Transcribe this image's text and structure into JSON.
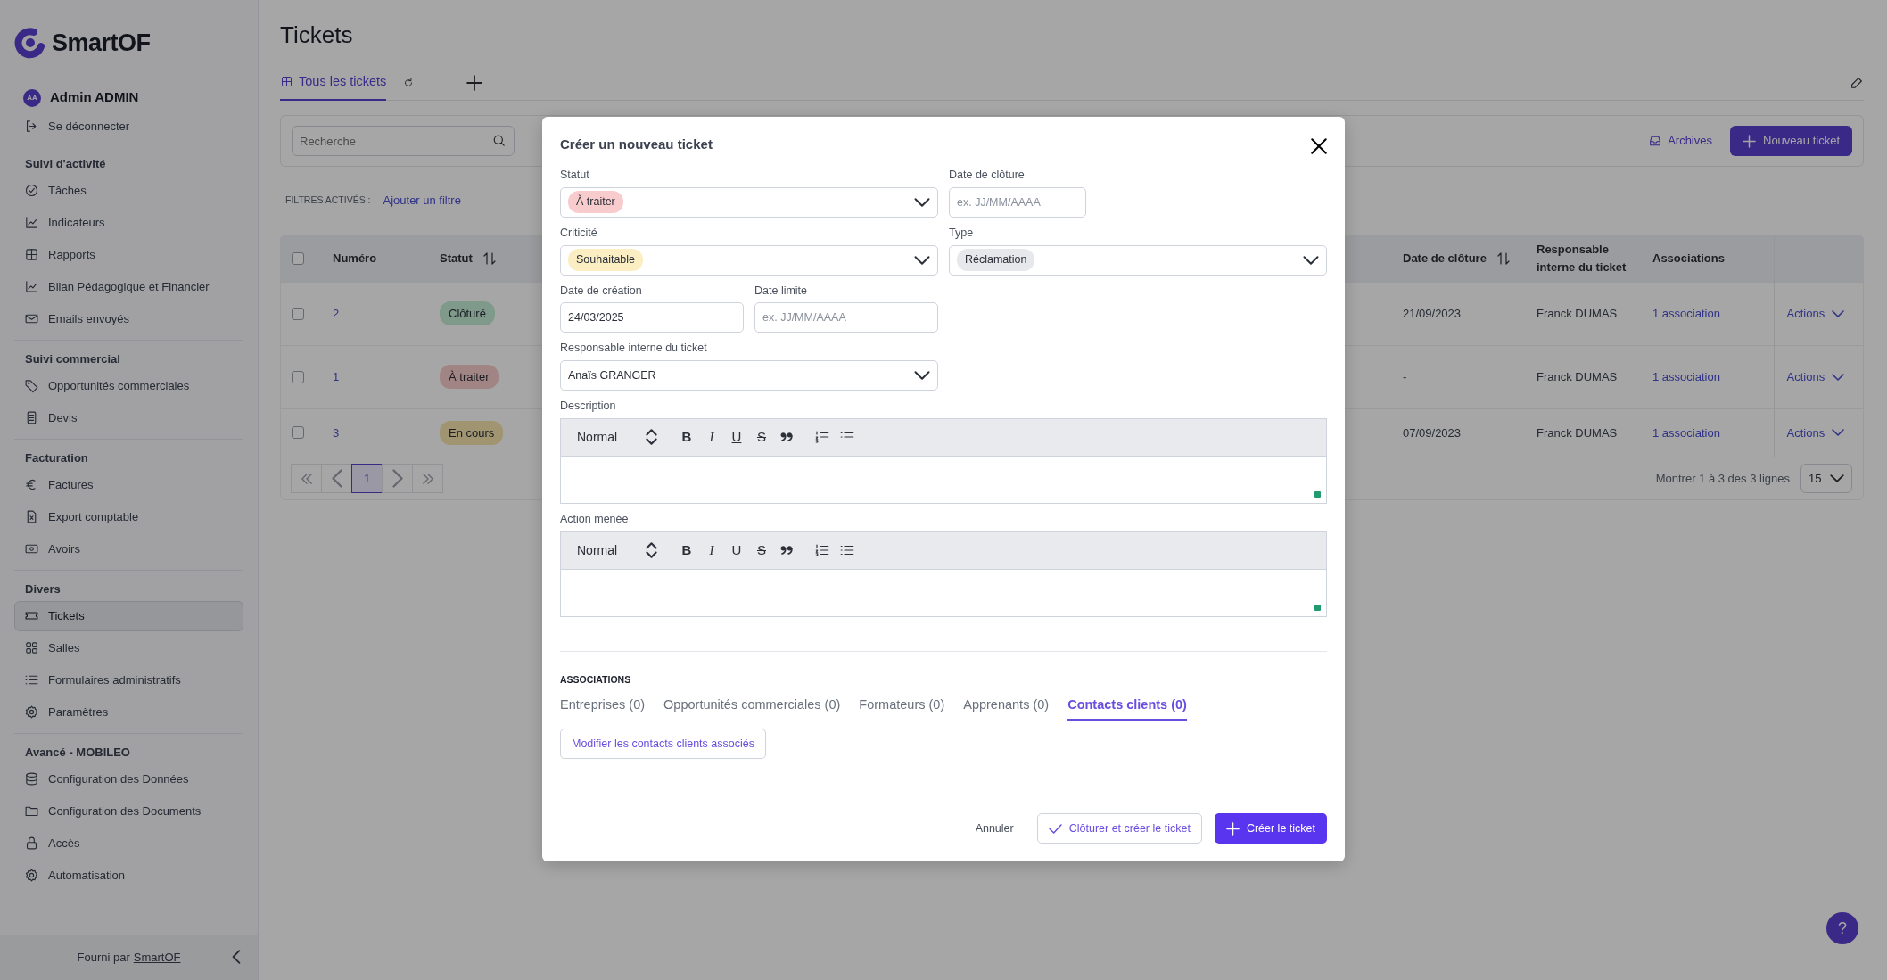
{
  "sidebar": {
    "logo": "SmartOF",
    "user": {
      "initials": "AA",
      "name": "Admin ADMIN"
    },
    "logout": "Se déconnecter",
    "sections": [
      {
        "title": "Suivi d'activité",
        "items": [
          {
            "label": "Tâches",
            "kind": "check-circle",
            "selected": false
          },
          {
            "label": "Indicateurs",
            "kind": "chart",
            "selected": false
          },
          {
            "label": "Rapports",
            "kind": "table",
            "selected": false
          },
          {
            "label": "Bilan Pédagogique et Financier",
            "kind": "chart",
            "selected": false
          },
          {
            "label": "Emails envoyés",
            "kind": "mail",
            "selected": false
          }
        ]
      },
      {
        "title": "Suivi commercial",
        "items": [
          {
            "label": "Opportunités commerciales",
            "kind": "tag",
            "selected": false
          },
          {
            "label": "Devis",
            "kind": "document",
            "selected": false
          }
        ]
      },
      {
        "title": "Facturation",
        "items": [
          {
            "label": "Factures",
            "kind": "euro",
            "selected": false
          },
          {
            "label": "Export comptable",
            "kind": "file-x",
            "selected": false
          },
          {
            "label": "Avoirs",
            "kind": "banknote",
            "selected": false
          }
        ]
      },
      {
        "title": "Divers",
        "items": [
          {
            "label": "Tickets",
            "kind": "ticket",
            "selected": true
          },
          {
            "label": "Salles",
            "kind": "grid",
            "selected": false
          },
          {
            "label": "Formulaires administratifs",
            "kind": "list",
            "selected": false
          },
          {
            "label": "Paramètres",
            "kind": "gear",
            "selected": false
          }
        ]
      },
      {
        "title": "Avancé - MOBILEO",
        "items": [
          {
            "label": "Configuration des Données",
            "kind": "database",
            "selected": false
          },
          {
            "label": "Configuration des Documents",
            "kind": "folder",
            "selected": false
          },
          {
            "label": "Accès",
            "kind": "lock",
            "selected": false
          },
          {
            "label": "Automatisation",
            "kind": "gear",
            "selected": false
          }
        ]
      }
    ],
    "footer": {
      "text": "Fourni par",
      "link": "SmartOF"
    }
  },
  "page": {
    "title": "Tickets",
    "views": [
      {
        "label": "Tous les tickets",
        "selected": true
      }
    ],
    "search": {
      "placeholder": "Recherche"
    },
    "archives": "Archives",
    "new_ticket": "Nouveau ticket",
    "filters_label": "FILTRES ACTIVÉS :",
    "add_filter": "Ajouter un filtre",
    "table": {
      "all_checked": false,
      "columns_left": [
        {
          "label": "Numéro",
          "sortable": false
        },
        {
          "label": "Statut",
          "sortable": true
        }
      ],
      "columns_right": [
        {
          "label": "Date de clôture",
          "sortable": true
        },
        {
          "label": "Responsable interne du ticket",
          "sortable": false
        },
        {
          "label": "Associations",
          "sortable": false
        }
      ],
      "rows": [
        {
          "checked": false,
          "number": "2",
          "status": {
            "label": "Clôturé",
            "kind": "closed"
          },
          "closing_date": "21/09/2023",
          "owner": "Franck DUMAS",
          "associations": "1 association",
          "actions": "Actions"
        },
        {
          "checked": false,
          "number": "1",
          "status": {
            "label": "À traiter",
            "kind": "todo"
          },
          "closing_date": "-",
          "owner": "Franck DUMAS",
          "associations": "1 association",
          "actions": "Actions"
        },
        {
          "checked": false,
          "number": "3",
          "status": {
            "label": "En cours",
            "kind": "in-progress"
          },
          "closing_date": "07/09/2023",
          "owner": "Franck DUMAS",
          "associations": "1 association",
          "actions": "Actions"
        }
      ]
    },
    "pagination": {
      "pages": [
        {
          "label": "1",
          "selected": true
        }
      ],
      "summary": "Montrer 1 à 3 des 3 lignes",
      "page_size": "15"
    },
    "help": "?"
  },
  "modal": {
    "title": "Créer un nouveau ticket",
    "status": {
      "label": "Statut",
      "value": {
        "label": "À traiter",
        "color": "#f8cccc"
      }
    },
    "closing_date": {
      "label": "Date de clôture",
      "placeholder": "ex. JJ/MM/AAAA"
    },
    "criticality": {
      "label": "Criticité",
      "value": {
        "label": "Souhaitable",
        "color": "#fbeec2"
      }
    },
    "type": {
      "label": "Type",
      "value": {
        "label": "Réclamation",
        "color": "#e7e8ec"
      }
    },
    "creation_date": {
      "label": "Date de création",
      "value": "24/03/2025"
    },
    "due_date": {
      "label": "Date limite",
      "placeholder": "ex. JJ/MM/AAAA"
    },
    "owner": {
      "label": "Responsable interne du ticket",
      "value": "Anaïs GRANGER"
    },
    "editors": [
      {
        "label": "Description",
        "format": "Normal",
        "toolbar": [
          {
            "kind": "bold",
            "glyph": "B"
          },
          {
            "kind": "italic",
            "glyph": "I"
          },
          {
            "kind": "underline",
            "glyph": "U"
          },
          {
            "kind": "strike",
            "glyph": "S"
          },
          {
            "kind": "quote"
          },
          {
            "kind": "ordered-list"
          },
          {
            "kind": "bullet-list"
          }
        ]
      },
      {
        "label": "Action menée",
        "format": "Normal",
        "toolbar": [
          {
            "kind": "bold",
            "glyph": "B"
          },
          {
            "kind": "italic",
            "glyph": "I"
          },
          {
            "kind": "underline",
            "glyph": "U"
          },
          {
            "kind": "strike",
            "glyph": "S"
          },
          {
            "kind": "quote"
          },
          {
            "kind": "ordered-list"
          },
          {
            "kind": "bullet-list"
          }
        ]
      }
    ],
    "associations": {
      "title": "ASSOCIATIONS",
      "tabs": [
        {
          "label": "Entreprises (0)",
          "selected": false
        },
        {
          "label": "Opportunités commerciales (0)",
          "selected": false
        },
        {
          "label": "Formateurs (0)",
          "selected": false
        },
        {
          "label": "Apprenants (0)",
          "selected": false
        },
        {
          "label": "Contacts clients (0)",
          "selected": true
        }
      ],
      "button": "Modifier les contacts clients associés"
    },
    "footer": {
      "cancel": "Annuler",
      "close_create": "Clôturer et créer le ticket",
      "create": "Créer le ticket"
    }
  }
}
